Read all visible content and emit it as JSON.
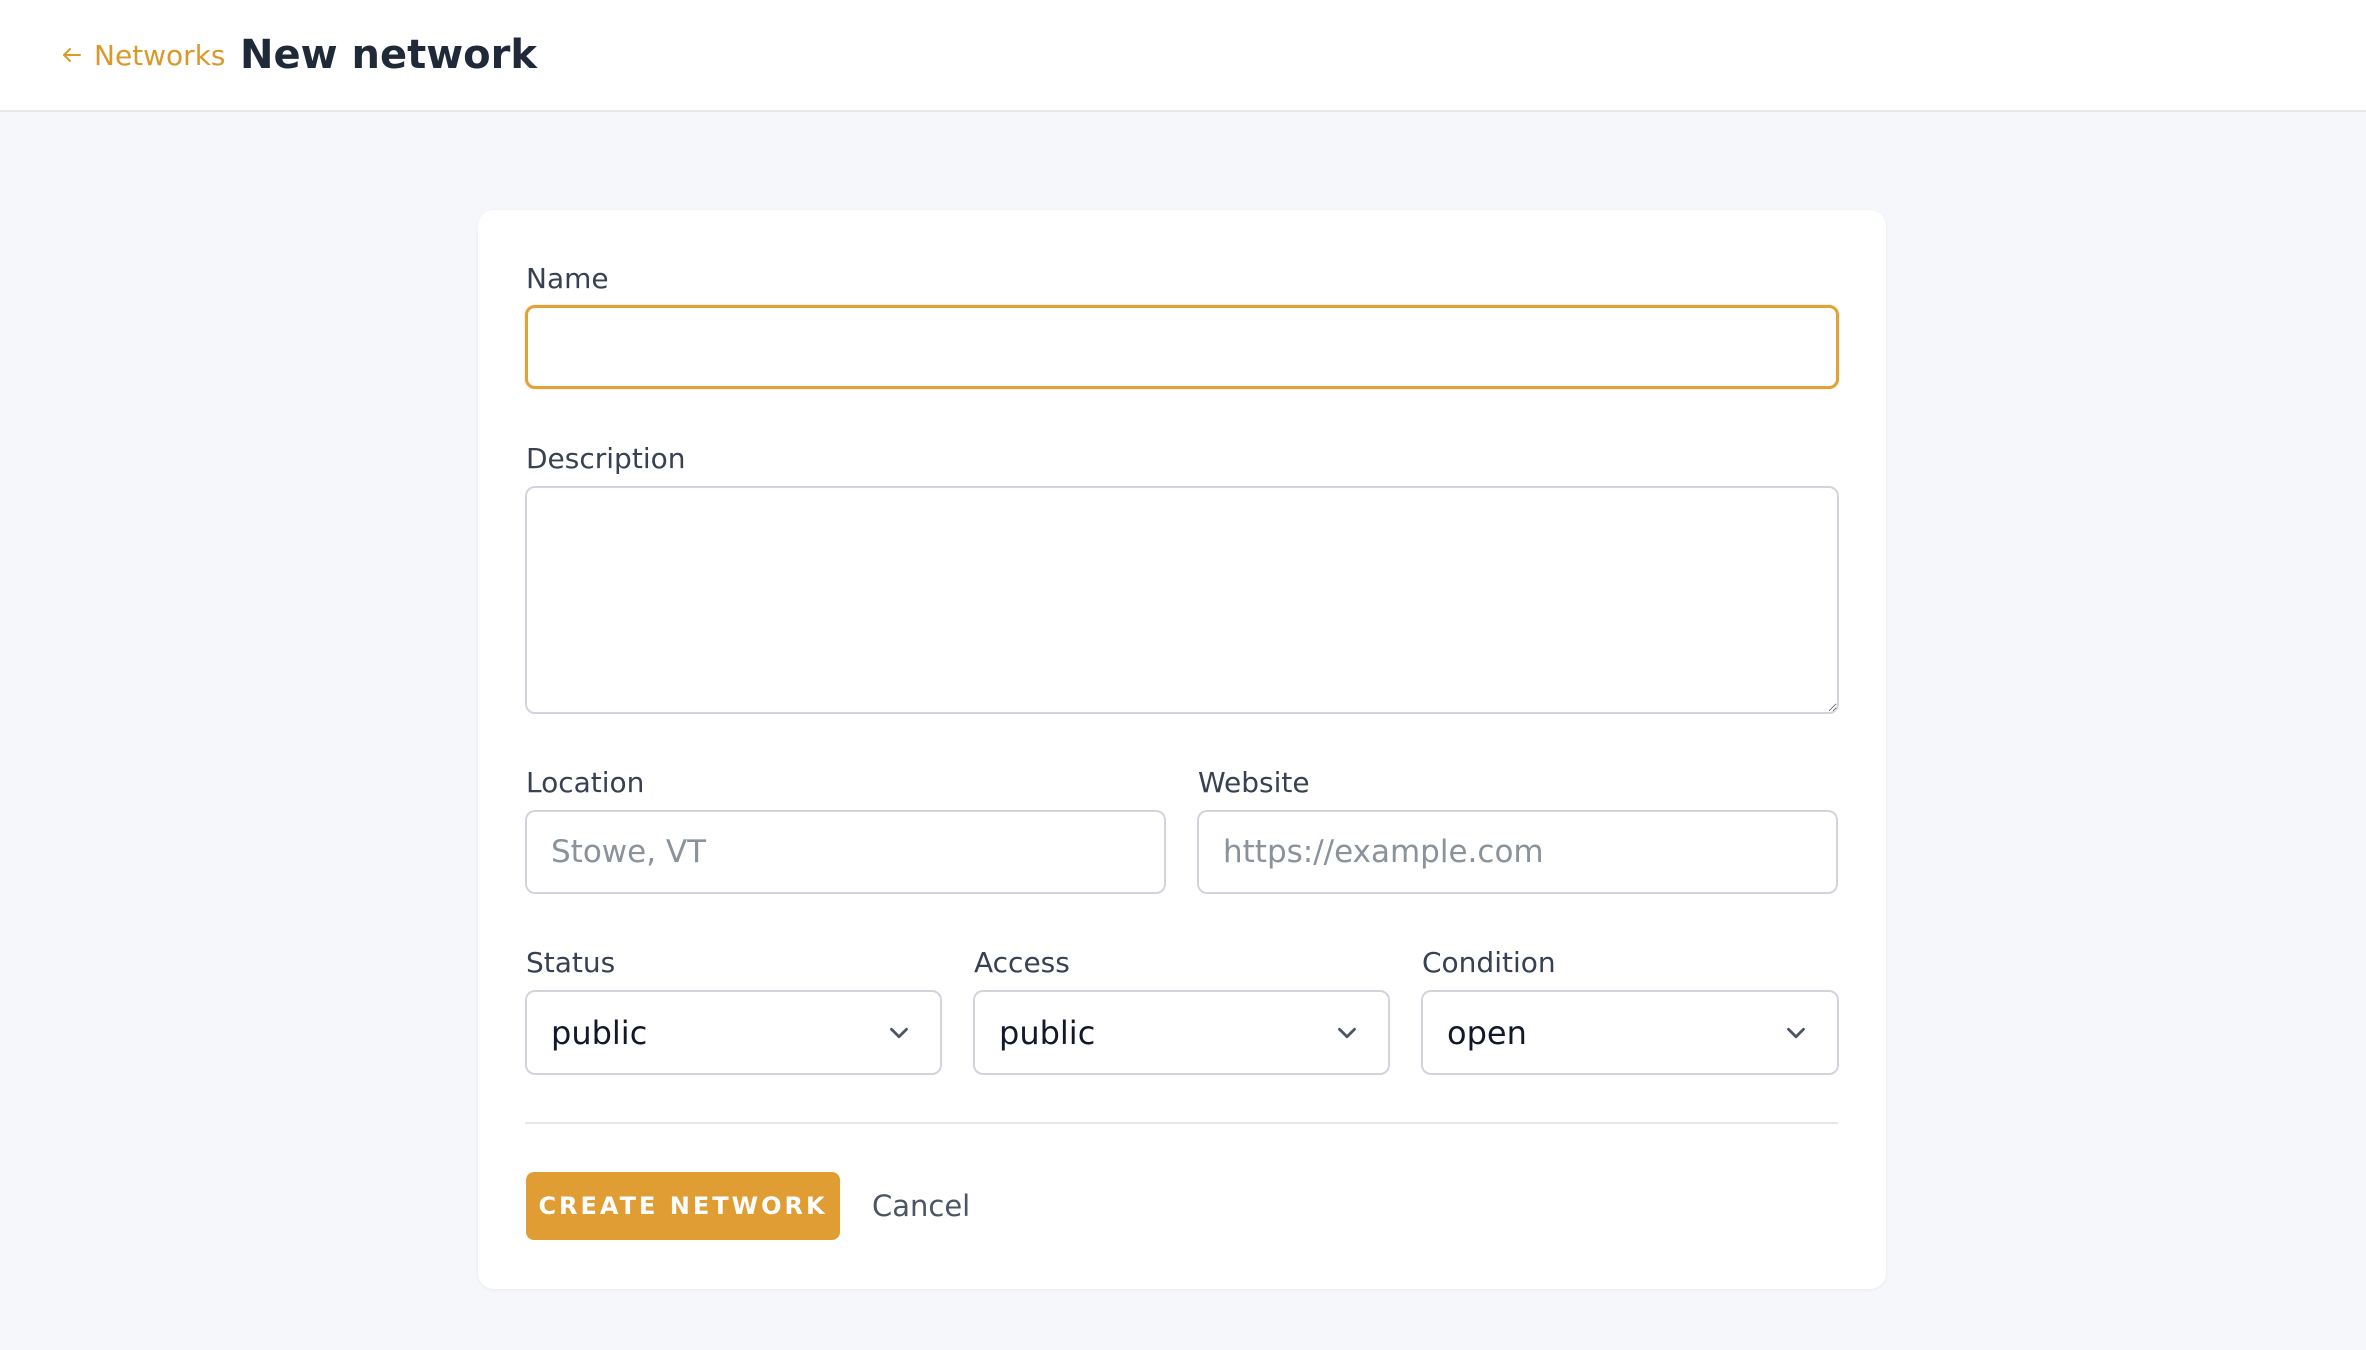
{
  "header": {
    "back_link": "Networks",
    "title": "New network"
  },
  "form": {
    "name": {
      "label": "Name",
      "value": ""
    },
    "description": {
      "label": "Description",
      "value": ""
    },
    "location": {
      "label": "Location",
      "placeholder": "Stowe, VT"
    },
    "website": {
      "label": "Website",
      "placeholder": "https://example.com"
    },
    "status": {
      "label": "Status",
      "value": "public"
    },
    "access": {
      "label": "Access",
      "value": "public"
    },
    "condition": {
      "label": "Condition",
      "value": "open"
    }
  },
  "actions": {
    "submit_label": "CREATE NETWORK",
    "cancel_label": "Cancel"
  },
  "colors": {
    "accent": "#df9d33",
    "background": "#f6f7fa",
    "card": "#ffffff"
  }
}
